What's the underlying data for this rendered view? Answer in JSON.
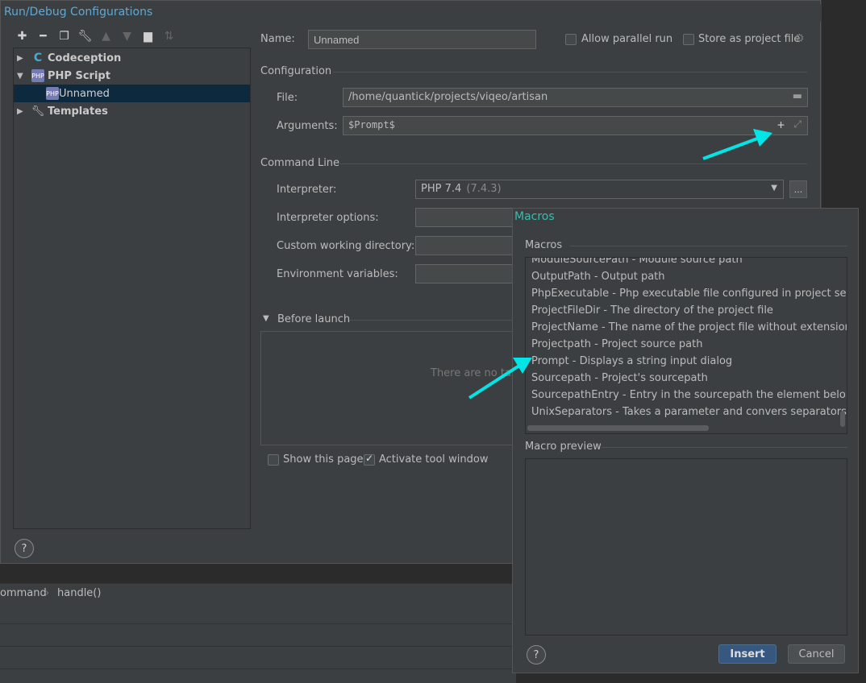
{
  "dialog": {
    "title": "Run/Debug Configurations",
    "tree": [
      {
        "label": "Codeception",
        "icon": "codeception-icon",
        "expanded": false
      },
      {
        "label": "PHP Script",
        "icon": "php-icon",
        "expanded": true
      },
      {
        "label": "Unnamed",
        "icon": "php-file-icon",
        "selected": true
      },
      {
        "label": "Templates",
        "icon": "wrench-icon",
        "expanded": false
      }
    ],
    "name_label": "Name:",
    "name_value": "Unnamed",
    "allow_parallel_label": "Allow parallel run",
    "store_project_label": "Store as project file",
    "configuration_header": "Configuration",
    "file_label": "File:",
    "file_value": "/home/quantick/projects/viqeo/artisan",
    "arguments_label": "Arguments:",
    "arguments_value": "$Prompt$",
    "command_line_header": "Command Line",
    "interpreter_label": "Interpreter:",
    "interpreter_value": "PHP 7.4",
    "interpreter_version": "(7.4.3)",
    "interpreter_options_label": "Interpreter options:",
    "custom_dir_label": "Custom working directory:",
    "env_vars_label": "Environment variables:",
    "browse_button": "...",
    "before_launch_label": "Before launch",
    "no_tasks_text": "There are no tas",
    "show_page_label": "Show this page",
    "activate_tool_label": "Activate tool window"
  },
  "background": {
    "breadcrumb_1": "ommand",
    "breadcrumb_sep": "›",
    "breadcrumb_2": "handle()"
  },
  "macros": {
    "title": "Macros",
    "list_header": "Macros",
    "items": [
      "ModuleSourcePath - Module source path",
      "OutputPath - Output path",
      "PhpExecutable - Php executable file configured in project settings",
      "ProjectFileDir - The directory of the project file",
      "ProjectName - The name of the project file without extension",
      "Projectpath - Project source path",
      "Prompt - Displays a string input dialog",
      "Sourcepath - Project's sourcepath",
      "SourcepathEntry - Entry in the sourcepath the element belongs to",
      "UnixSeparators - Takes a parameter and convers separators to '/'."
    ],
    "preview_header": "Macro preview",
    "insert_button": "Insert",
    "cancel_button": "Cancel"
  },
  "colors": {
    "accent": "#00e5e5",
    "selection": "#0d293e",
    "primary_button": "#365880"
  }
}
